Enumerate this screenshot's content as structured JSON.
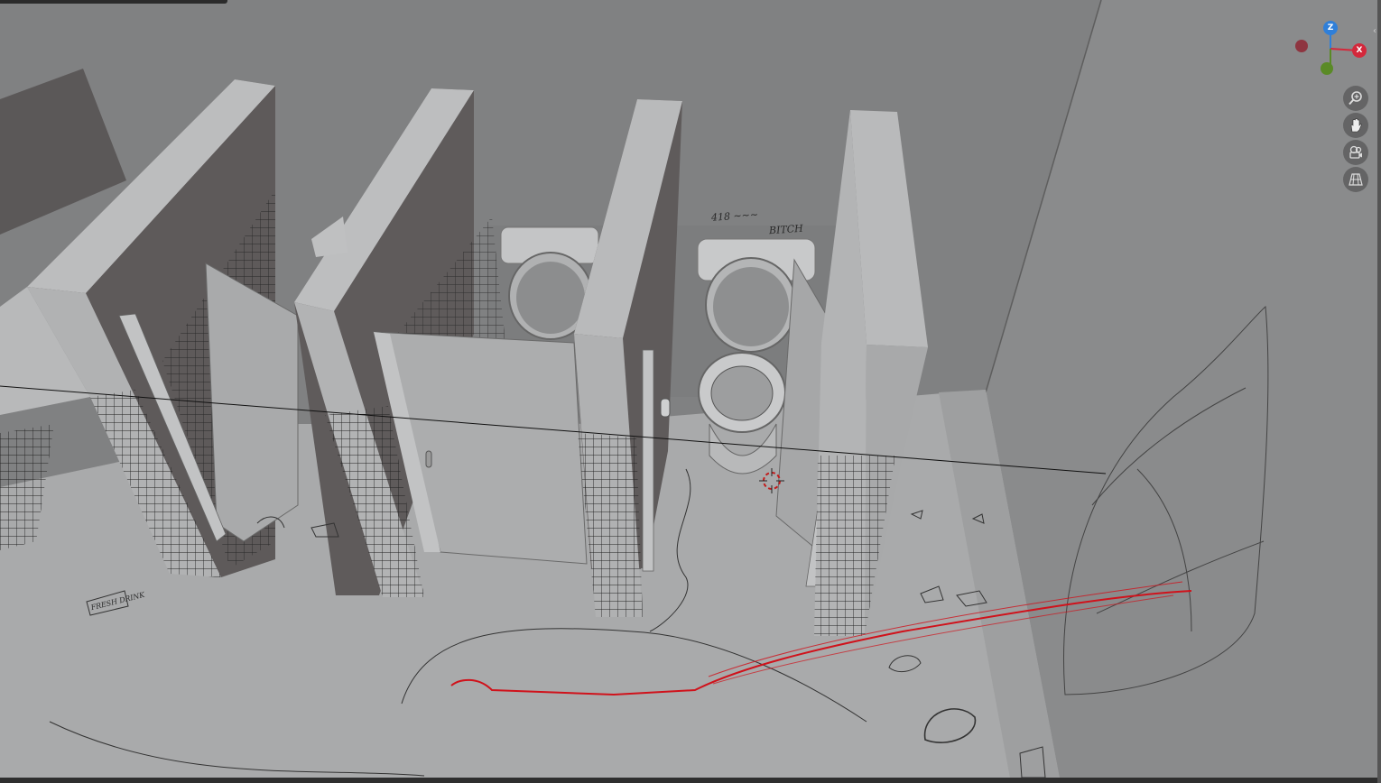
{
  "viewport": {
    "shading": "solid",
    "background_wall": "#808182",
    "floor": "#a9aaab",
    "partition": "#b8b9ba",
    "partition_side": "#5b5858",
    "annotation_color": "#d0121b"
  },
  "gizmo": {
    "z_label": "Z",
    "x_label": "X",
    "z_color": "#2f7fd9",
    "x_color": "#d4283b",
    "y_color": "#5a8a26",
    "neg_x_color": "#8e3540"
  },
  "nav_tools": [
    {
      "name": "zoom-icon"
    },
    {
      "name": "hand-pan-icon"
    },
    {
      "name": "camera-view-icon"
    },
    {
      "name": "grid-ortho-icon"
    }
  ],
  "graffiti": {
    "stall_wall_1": "418 ~~~",
    "stall_wall_2": "BITCH",
    "floor_note": "FRESH DRINK"
  },
  "edge_tab": "‹"
}
